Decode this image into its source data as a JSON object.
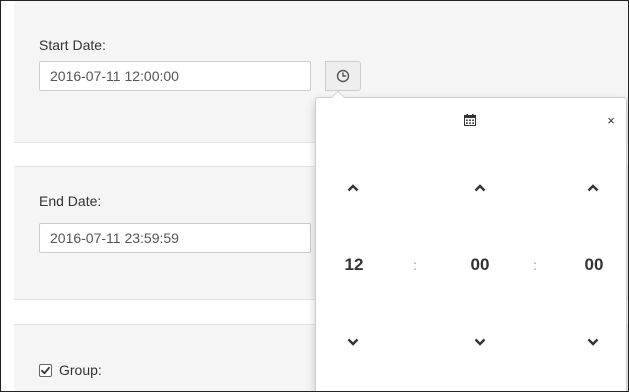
{
  "form": {
    "start_label": "Start Date:",
    "start_value": "2016-07-11 12:00:00",
    "end_label": "End Date:",
    "end_value": "2016-07-11 23:59:59",
    "group_label": "Group:",
    "group_checked": true
  },
  "picker": {
    "hours": "12",
    "minutes": "00",
    "seconds": "00",
    "separator": ":",
    "close_glyph": "×",
    "icons": {
      "toggle": "calendar-icon",
      "addon": "clock-icon",
      "up": "chevron-up-icon",
      "down": "chevron-down-icon"
    }
  },
  "colors": {
    "panel_bg": "#f5f5f5",
    "text": "#333333",
    "border": "#cccccc"
  }
}
